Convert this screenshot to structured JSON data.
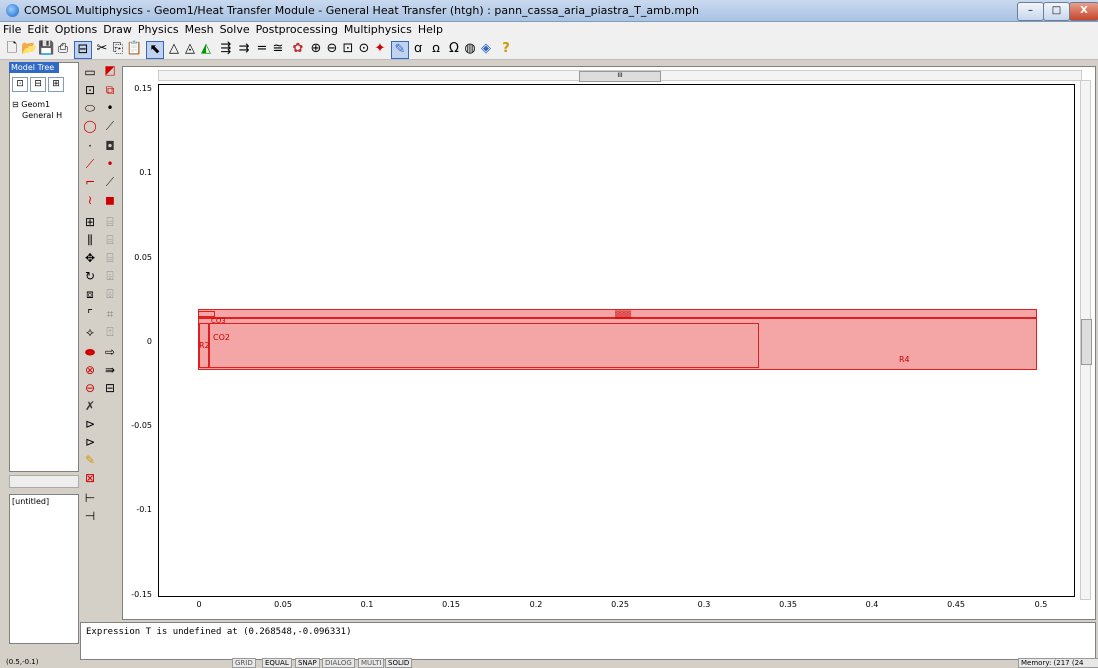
{
  "window": {
    "title": "COMSOL Multiphysics - Geom1/Heat Transfer Module - General Heat Transfer (htgh) : pann_cassa_aria_piastra_T_amb.mph",
    "minimize": "–",
    "maximize": "□",
    "close": "X"
  },
  "menu": [
    "File",
    "Edit",
    "Options",
    "Draw",
    "Physics",
    "Mesh",
    "Solve",
    "Postprocessing",
    "Multiphysics",
    "Help"
  ],
  "model_tree": {
    "tab": "Model Tree",
    "tools": [
      "⊡",
      "⊟",
      "⊞"
    ],
    "root": "⊟ Geom1",
    "child": "General H"
  },
  "untitled": "[untitled]",
  "plot": {
    "y_ticks": [
      "0.15",
      "0.1",
      "0.05",
      "0",
      "-0.05",
      "-0.1",
      "-0.15"
    ],
    "x_ticks": [
      "0",
      "0.05",
      "0.1",
      "0.15",
      "0.2",
      "0.25",
      "0.3",
      "0.35",
      "0.4",
      "0.45",
      "0.5"
    ],
    "labels": {
      "co3": "CO3",
      "co2": "CO2",
      "r2": "R2",
      "r4": "R4"
    },
    "scroll_center": "III"
  },
  "message": "Expression T is undefined at (0.268548,-0.096331)",
  "status": {
    "coords": "(0.5,-0.1)",
    "grid": "GRID",
    "equal": "EQUAL",
    "snap": "SNAP",
    "dialog": "DIALOG",
    "multi": "MULTI",
    "solid": "SOLID",
    "memory": "Memory: (217 (24"
  },
  "colors": {
    "geometry_fill": "#f4a6a6",
    "geometry_stroke": "#e02020"
  }
}
